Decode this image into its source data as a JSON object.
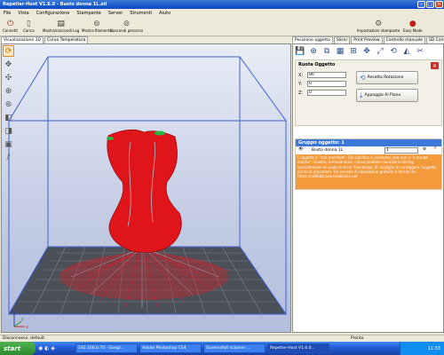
{
  "window": {
    "title": "Repetier-Host V1.6.0 - Busto donna 1L.stl"
  },
  "menu": [
    "File",
    "Vista",
    "Configurazione",
    "Stampante",
    "Server",
    "Strumenti",
    "Aiuto"
  ],
  "toolbar": {
    "connect": "Connetti",
    "load": "Carica",
    "toggle_log": "Mostra/nascondi Log",
    "toggle_filament": "Mostra filamento",
    "hide_path": "Nascondi percorso",
    "printer_settings": "Impostazioni stampante",
    "easy_mode": "Easy Mode"
  },
  "left_tabs": [
    "Visualizzazione 3D",
    "Curva Temperatura"
  ],
  "right_tabs": [
    "Posizione oggetto",
    "Slicer",
    "Print Preview",
    "Controllo manuale",
    "SD Card"
  ],
  "object": {
    "header": "Ruota Oggetto",
    "x_label": "X:",
    "x_value": "90",
    "y_label": "Y:",
    "y_value": "0",
    "z_label": "Z:",
    "z_value": "0",
    "reset_rotation": "Resetta Rotazione",
    "lay_flat": "Appoggia Al Piano"
  },
  "group": {
    "header": "Gruppo oggetto: 1",
    "object_name": "Busto donna 1L",
    "copies": "1",
    "warning": "L'oggetto è \"non-manifold\". Ciò significa in sostanza, che non è \"a tenuta stagna\". Questo, normalmente, causa problemi durante lo slicing, specialmente se usate lo slicer Skeinforge. Si consiglia di correggere l'oggetto prima di procedere. Un servizio di riparazione gratuito è fornito da https://netfabb.azurewebsites.net"
  },
  "status": {
    "left": "Disconnesso: default",
    "right": "Pronto"
  },
  "taskbar": {
    "start": "start",
    "items": [
      "192.168.0.70 - Googl...",
      "Adobe Photoshop CS4",
      "Screenshot scanner ...",
      "Repetier-Host V1.6.0..."
    ],
    "clock": "11:33"
  },
  "colors": {
    "accent": "#3b78d8",
    "warning": "#f39a3d",
    "model": "#e0151a",
    "support": "#9fd7ea"
  }
}
